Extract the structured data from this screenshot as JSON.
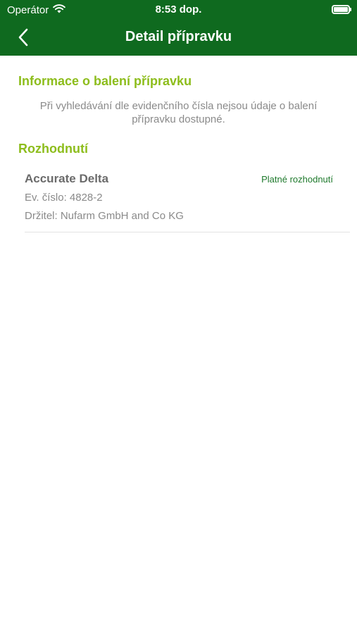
{
  "status_bar": {
    "carrier": "Operátor",
    "time": "8:53 dop.",
    "wifi_icon": "wifi-icon",
    "battery_icon": "battery-icon"
  },
  "nav": {
    "title": "Detail přípravku",
    "back_icon": "chevron-left-icon"
  },
  "packaging": {
    "title": "Informace o balení přípravku",
    "note": "Při vyhledávání dle evidenčního čísla nejsou údaje o balení přípravku dostupné."
  },
  "decisions": {
    "title": "Rozhodnutí",
    "items": [
      {
        "name": "Accurate Delta",
        "status": "Platné rozhodnutí",
        "reg_number": "Ev. číslo: 4828-2",
        "holder": "Držitel: Nufarm GmbH and Co KG"
      }
    ]
  },
  "colors": {
    "header_bg": "#0f6a1f",
    "section_title": "#8dbd1c",
    "status_text": "#1f7a2d",
    "secondary_text": "#8a8a8a"
  }
}
